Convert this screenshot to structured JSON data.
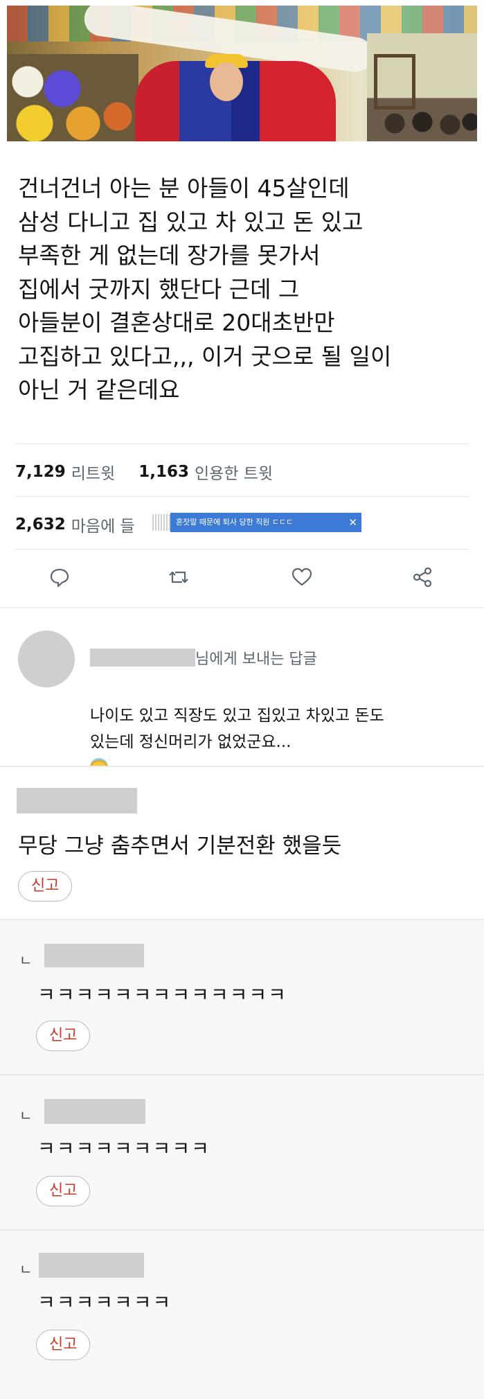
{
  "tweet": {
    "text": "건너건너 아는 분 아들이 45살인데\n삼성 다니고 집 있고 차 있고 돈 있고\n부족한 게 없는데 장가를 못가서\n집에서 굿까지 했단다 근데 그\n아들분이 결혼상대로 20대초반만\n고집하고 있다고,,, 이거 굿으로 될 일이\n아닌 거 같은데요",
    "retweets_count": "7,129",
    "retweets_label": "리트윗",
    "quotes_count": "1,163",
    "quotes_label": "인용한 트윗",
    "likes_count": "2,632",
    "likes_label": "마음에 들"
  },
  "ad": {
    "text": "혼잣말 때문에 퇴사 당한 직원 ㄷㄷㄷ",
    "close": "✕"
  },
  "actions": {
    "reply_icon": "reply-bubble-icon",
    "retweet_icon": "retweet-icon",
    "like_icon": "heart-icon",
    "share_icon": "share-icon"
  },
  "reply": {
    "to_suffix": "님에게 보내는 답글",
    "text": "나이도 있고 직장도 있고 집있고 차있고 돈도\n있는데 정신머리가 없었군요...",
    "emoji": "smiling-face-with-halo-icon"
  },
  "comments": {
    "main": {
      "text": "무당 그냥 춤추면서 기분전환 했을듯",
      "report_label": "신고"
    },
    "replies": [
      {
        "mark": "ㄴ",
        "text": "ㅋㅋㅋㅋㅋㅋㅋㅋㅋㅋㅋㅋㅋ",
        "report_label": "신고"
      },
      {
        "mark": "ㄴ",
        "text": "ㅋㅋㅋㅋㅋㅋㅋㅋㅋ",
        "report_label": "신고"
      },
      {
        "mark": "ㄴ",
        "text": "ㅋㅋㅋㅋㅋㅋㅋ",
        "report_label": "신고"
      }
    ]
  },
  "colors": {
    "text": "#141414",
    "muted": "#5b6670",
    "report_red": "#c53b2b",
    "ad_blue": "#3d7ad6",
    "redaction_gray": "#cfcfcf"
  }
}
